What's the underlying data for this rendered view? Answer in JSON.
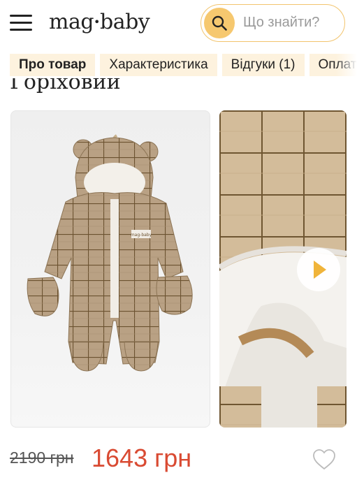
{
  "header": {
    "logo_left": "mag",
    "logo_dot": "•",
    "logo_right": "baby",
    "search": {
      "placeholder": "Що знайти?",
      "icon": "search-icon"
    },
    "menu_icon": "hamburger-menu-icon"
  },
  "tabs": [
    {
      "label": "Про товар",
      "active": true
    },
    {
      "label": "Характеристика",
      "active": false
    },
    {
      "label": "Відгуки (1)",
      "active": false
    },
    {
      "label": "Оплата",
      "active": false
    }
  ],
  "product": {
    "title_fragment": "Горіховий",
    "label_tag": "mag-baby",
    "old_price": "2190 грн",
    "new_price": "1643 грн",
    "favorite_icon": "heart-icon"
  },
  "gallery": {
    "video_icon": "play-icon"
  },
  "colors": {
    "accent": "#f6c86f",
    "tab_bg": "#fdf2de",
    "price": "#d94a32",
    "fabric": "#b9a184",
    "grid": "#6b5230"
  }
}
